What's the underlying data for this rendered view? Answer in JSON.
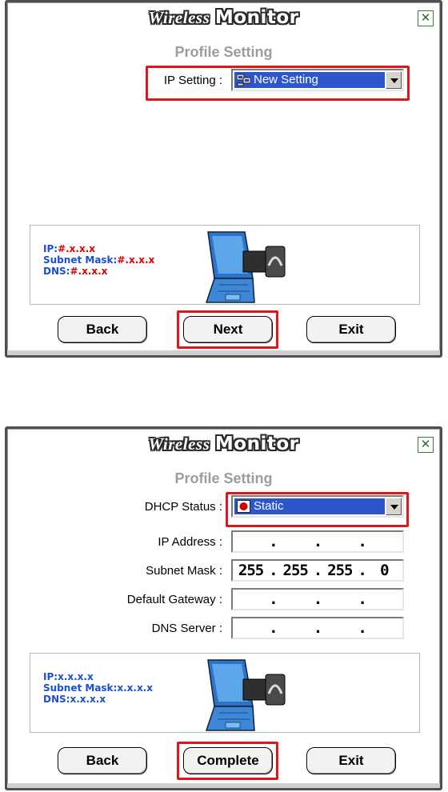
{
  "colors": {
    "accent_red": "#e1161d",
    "selection_blue": "#2c56c9",
    "info_blue": "#1a4fd0",
    "subtitle_gray": "#9c9c9c"
  },
  "dialog1": {
    "title_word1": "Wireless",
    "title_word2": "Monitor",
    "close_icon": "close-x-icon",
    "subtitle": "Profile Setting",
    "ip_setting_label": "IP Setting :",
    "ip_setting_value": "New Setting",
    "ip_setting_icon": "network-computer-icon",
    "info_ip_label": "IP:",
    "info_ip_value": "#.x.x.x",
    "info_mask_label": "Subnet Mask:",
    "info_mask_value": "#.x.x.x",
    "info_dns_label": "DNS:",
    "info_dns_value": "#.x.x.x",
    "laptop_icon": "laptop-wireless-card-icon",
    "back_label": "Back",
    "next_label": "Next",
    "exit_label": "Exit"
  },
  "dialog2": {
    "title_word1": "Wireless",
    "title_word2": "Monitor",
    "close_icon": "close-x-icon",
    "subtitle": "Profile Setting",
    "dhcp_label": "DHCP Status :",
    "dhcp_value": "Static",
    "dhcp_icon": "red-dot-icon",
    "ip_label": "IP Address :",
    "mask_label": "Subnet Mask :",
    "mask_octets": [
      "255",
      "255",
      "255",
      "0"
    ],
    "gateway_label": "Default Gateway :",
    "dns_label": "DNS Server :",
    "dot": ".",
    "info_ip_label": "IP:",
    "info_ip_value": "x.x.x.x",
    "info_mask_label": "Subnet Mask:",
    "info_mask_value": "x.x.x.x",
    "info_dns_label": "DNS:",
    "info_dns_value": "x.x.x.x",
    "laptop_icon": "laptop-wireless-card-icon",
    "back_label": "Back",
    "complete_label": "Complete",
    "exit_label": "Exit"
  }
}
